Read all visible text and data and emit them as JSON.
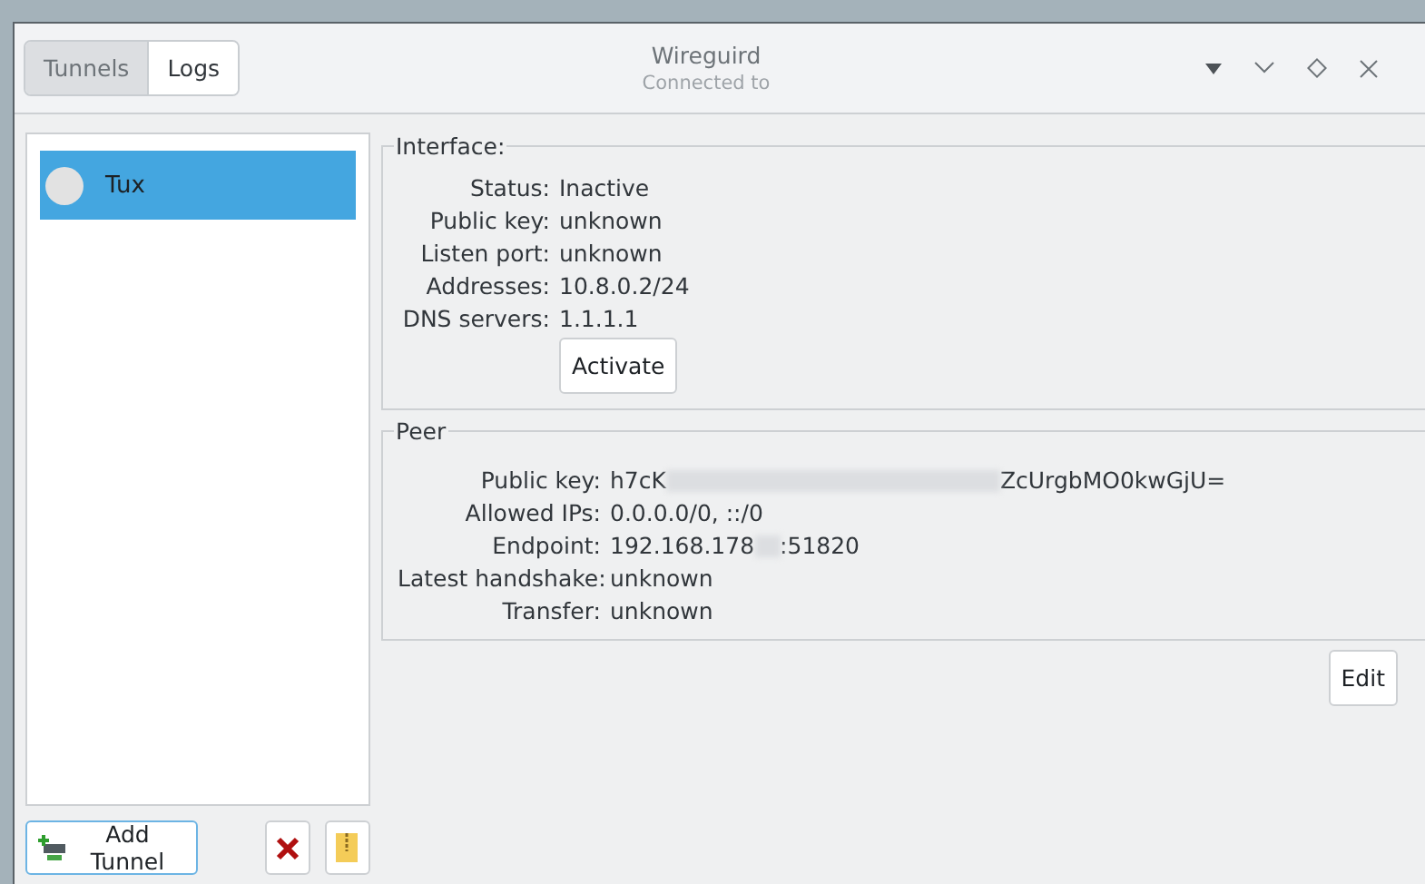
{
  "window": {
    "title": "Wireguird",
    "subtitle": "Connected to"
  },
  "tabs": [
    {
      "label": "Tunnels",
      "selected": true
    },
    {
      "label": "Logs",
      "selected": false
    }
  ],
  "tunnels": [
    {
      "name": "Tux",
      "selected": true,
      "active": false
    }
  ],
  "interface": {
    "title": "Interface:",
    "fields": [
      {
        "label": "Status:",
        "value_parts": [
          "Inactive"
        ]
      },
      {
        "label": "Public key:",
        "value_parts": [
          "unknown"
        ]
      },
      {
        "label": "Listen port:",
        "value_parts": [
          "unknown"
        ]
      },
      {
        "label": "Addresses:",
        "value_parts": [
          "10.8.0.2/24"
        ]
      },
      {
        "label": "DNS servers:",
        "value_parts": [
          "1.1.1.1"
        ]
      }
    ],
    "button": "Activate"
  },
  "peer": {
    "title": "Peer",
    "fields": [
      {
        "label": "Public key:",
        "value_parts": [
          "h7cK",
          "ZcUrgbMO0kwGjU="
        ]
      },
      {
        "label": "Allowed IPs:",
        "value_parts": [
          "0.0.0.0/0, ::/0"
        ]
      },
      {
        "label": "Endpoint:",
        "value_parts": [
          "192.168.178",
          ":51820"
        ]
      },
      {
        "label": "Latest handshake:",
        "value_parts": [
          "unknown"
        ]
      },
      {
        "label": "Transfer:",
        "value_parts": [
          "unknown"
        ]
      }
    ]
  },
  "edit_button": "Edit",
  "add_tunnel_button": "Add Tunnel"
}
